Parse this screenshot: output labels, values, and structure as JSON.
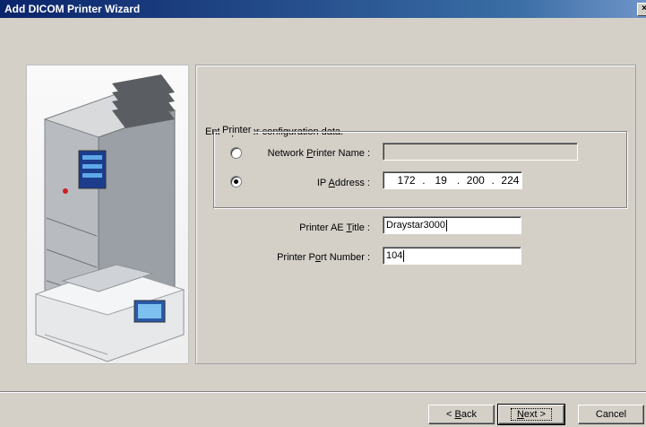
{
  "window": {
    "title": "Add DICOM Printer Wizard",
    "close_glyph": "×"
  },
  "page": {
    "prompt": "Enter printer configuration data."
  },
  "printer_group": {
    "legend": "Printer",
    "network_printer": {
      "label_pre": "Network ",
      "label_key": "P",
      "label_post": "rinter Name :",
      "selected": false,
      "value": ""
    },
    "ip_address": {
      "label_pre": "IP ",
      "label_key": "A",
      "label_post": "ddress :",
      "selected": true,
      "octets": [
        "172",
        "19",
        "200",
        "224"
      ]
    }
  },
  "ae_title": {
    "label_pre": "Printer AE ",
    "label_key": "T",
    "label_post": "itle :",
    "value": "Draystar3000"
  },
  "port_number": {
    "label_pre": "Printer P",
    "label_key": "o",
    "label_post": "rt Number :",
    "value": "104"
  },
  "buttons": {
    "back": {
      "pre": "< ",
      "key": "B",
      "post": "ack"
    },
    "next": {
      "pre": "",
      "key": "N",
      "post": "ext >"
    },
    "cancel": {
      "label": "Cancel"
    }
  },
  "colors": {
    "titlebar_start": "#0a246a",
    "titlebar_end": "#6f94c8",
    "dialog_bg": "#d4d0c8"
  }
}
